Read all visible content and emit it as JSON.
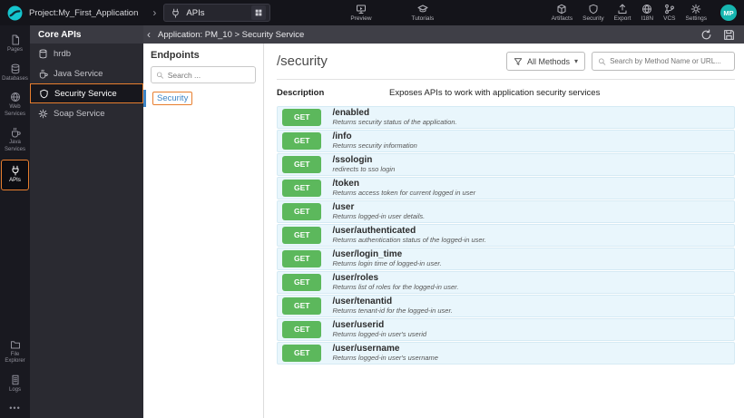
{
  "topbar": {
    "project": "Project:My_First_Application",
    "selector": {
      "label": "APIs"
    },
    "preview_label": "Preview",
    "tutorials_label": "Tutorials",
    "right": [
      {
        "label": "Artifacts"
      },
      {
        "label": "Security"
      },
      {
        "label": "Export"
      },
      {
        "label": "I18N"
      },
      {
        "label": "VCS"
      },
      {
        "label": "Settings"
      }
    ],
    "avatar": "MP"
  },
  "sidebar": {
    "items": [
      {
        "label": "Pages"
      },
      {
        "label": "Databases"
      },
      {
        "label": "Web Services"
      },
      {
        "label": "Java Services"
      },
      {
        "label": "APIs"
      },
      {
        "label": "File Explorer"
      },
      {
        "label": "Logs"
      }
    ]
  },
  "api_panel": {
    "title": "Core APIs",
    "items": [
      {
        "label": "hrdb"
      },
      {
        "label": "Java Service"
      },
      {
        "label": "Security Service"
      },
      {
        "label": "Soap Service"
      }
    ]
  },
  "main": {
    "breadcrumb": "Application: PM_10 > Security Service",
    "endpoints_panel": {
      "title": "Endpoints",
      "search_placeholder": "Search ...",
      "items": [
        {
          "label": "Security"
        }
      ]
    },
    "detail": {
      "title": "/security",
      "methods_filter": "All Methods",
      "methods_caret": "▾",
      "search_placeholder": "Search by Method Name or URL...",
      "description_label": "Description",
      "description": "Exposes APIs to work with application security services",
      "rows": [
        {
          "method": "GET",
          "path": "/enabled",
          "desc": "Returns security status of the application."
        },
        {
          "method": "GET",
          "path": "/info",
          "desc": "Returns security information"
        },
        {
          "method": "GET",
          "path": "/ssologin",
          "desc": "redirects to sso login"
        },
        {
          "method": "GET",
          "path": "/token",
          "desc": "Returns access token for current logged in user"
        },
        {
          "method": "GET",
          "path": "/user",
          "desc": "Returns logged-in user details."
        },
        {
          "method": "GET",
          "path": "/user/authenticated",
          "desc": "Returns authentication status of the logged-in user."
        },
        {
          "method": "GET",
          "path": "/user/login_time",
          "desc": "Returns login time of logged-in user."
        },
        {
          "method": "GET",
          "path": "/user/roles",
          "desc": "Returns list of roles for the logged-in user."
        },
        {
          "method": "GET",
          "path": "/user/tenantid",
          "desc": "Returns tenant-id for the logged-in user."
        },
        {
          "method": "GET",
          "path": "/user/userid",
          "desc": "Returns logged-in user's userid"
        },
        {
          "method": "GET",
          "path": "/user/username",
          "desc": "Returns logged-in user's username"
        }
      ]
    }
  },
  "glyphs": {
    "collapse": "‹",
    "more_dots": "•••"
  },
  "colors": {
    "accent_orange": "#e87e2e",
    "get_green": "#5cb85c",
    "row_blue": "#e9f6fc",
    "brand_teal": "#15c5ce",
    "link_blue": "#3d85c6"
  }
}
